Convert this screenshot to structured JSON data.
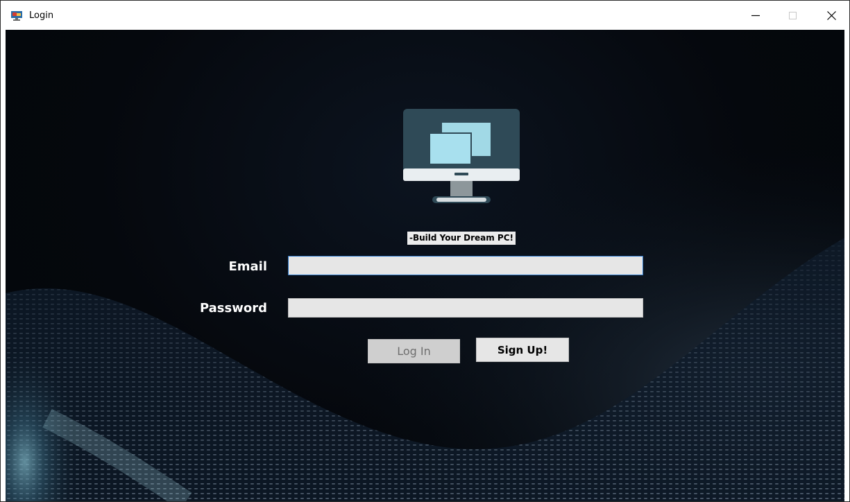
{
  "window": {
    "title": "Login",
    "icons": {
      "app": "monitor-icon",
      "minimize": "minimize-icon",
      "maximize": "maximize-icon",
      "close": "close-icon"
    }
  },
  "logo": {
    "icon": "desktop-monitor-icon",
    "colors": {
      "frame": "#2f4a57",
      "window_front": "#a8e0ee",
      "stand": "#8d979b"
    }
  },
  "tagline": "-Build Your Dream PC!",
  "form": {
    "email_label": "Email",
    "email_value": "",
    "password_label": "Password",
    "password_value": ""
  },
  "buttons": {
    "login_label": "Log In",
    "signup_label": "Sign Up!"
  },
  "colors": {
    "background": "#05080d",
    "input_bg": "#e6e6e6",
    "focus_border": "#2f78c8",
    "label_text": "#ffffff"
  }
}
